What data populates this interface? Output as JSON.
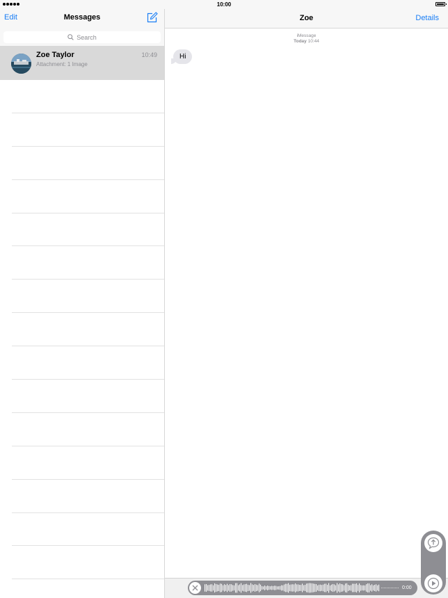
{
  "status_bar": {
    "time": "10:00"
  },
  "left_pane": {
    "edit_label": "Edit",
    "title": "Messages",
    "search_placeholder": "Search",
    "conversations": [
      {
        "name": "Zoe Taylor",
        "time": "10:49",
        "preview": "Attachment: 1 Image"
      }
    ]
  },
  "right_pane": {
    "title": "Zoe",
    "details_label": "Details",
    "service_label": "iMessage",
    "day_label": "Today",
    "day_time": "10:44",
    "messages": [
      {
        "text": "Hi",
        "direction": "incoming"
      }
    ]
  },
  "audio_recorder": {
    "duration": "0:00"
  },
  "colors": {
    "accent": "#1a7ef5",
    "bubble_incoming": "#e5e5ea",
    "recorder": "#8e8e93"
  },
  "icons": [
    "compose-icon",
    "search-icon",
    "close-icon",
    "send-arrow-icon",
    "play-icon"
  ]
}
